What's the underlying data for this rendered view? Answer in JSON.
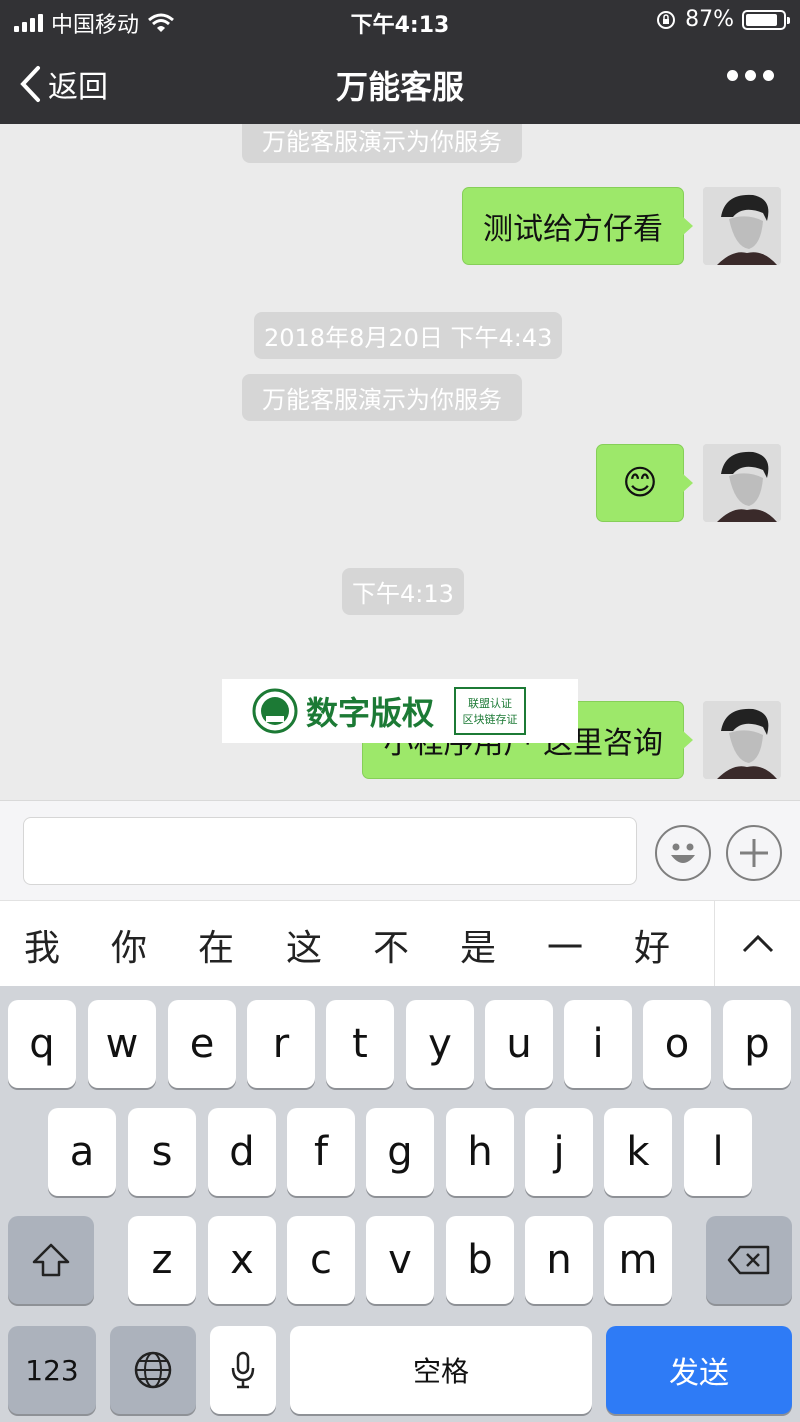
{
  "status_bar": {
    "carrier": "中国移动",
    "time": "下午4:13",
    "battery": "87%",
    "battery_level": 0.87
  },
  "nav": {
    "back_label": "返回",
    "title": "万能客服"
  },
  "messages": [
    {
      "type": "system",
      "text": "万能客服演示为你服务"
    },
    {
      "type": "outgoing",
      "text": "测试给方仔看"
    },
    {
      "type": "timestamp",
      "text": "2018年8月20日 下午4:43"
    },
    {
      "type": "system",
      "text": "万能客服演示为你服务"
    },
    {
      "type": "outgoing",
      "text": "😊"
    },
    {
      "type": "timestamp",
      "text": "下午4:13"
    },
    {
      "type": "outgoing",
      "text": "小程序用户 这里咨询"
    }
  ],
  "watermark": {
    "text": "数字版权",
    "seal_line1": "联盟认证",
    "seal_line2": "区块链存证"
  },
  "input": {
    "placeholder": ""
  },
  "candidates": [
    "我",
    "你",
    "在",
    "这",
    "不",
    "是",
    "一",
    "好"
  ],
  "keyboard": {
    "row1": [
      "q",
      "w",
      "e",
      "r",
      "t",
      "y",
      "u",
      "i",
      "o",
      "p"
    ],
    "row2": [
      "a",
      "s",
      "d",
      "f",
      "g",
      "h",
      "j",
      "k",
      "l"
    ],
    "row3": [
      "z",
      "x",
      "c",
      "v",
      "b",
      "n",
      "m"
    ],
    "numbers_label": "123",
    "space_label": "空格",
    "send_label": "发送"
  },
  "colors": {
    "nav_bg": "#323235",
    "bubble": "#9de86a",
    "send_key": "#2e7bf6"
  }
}
